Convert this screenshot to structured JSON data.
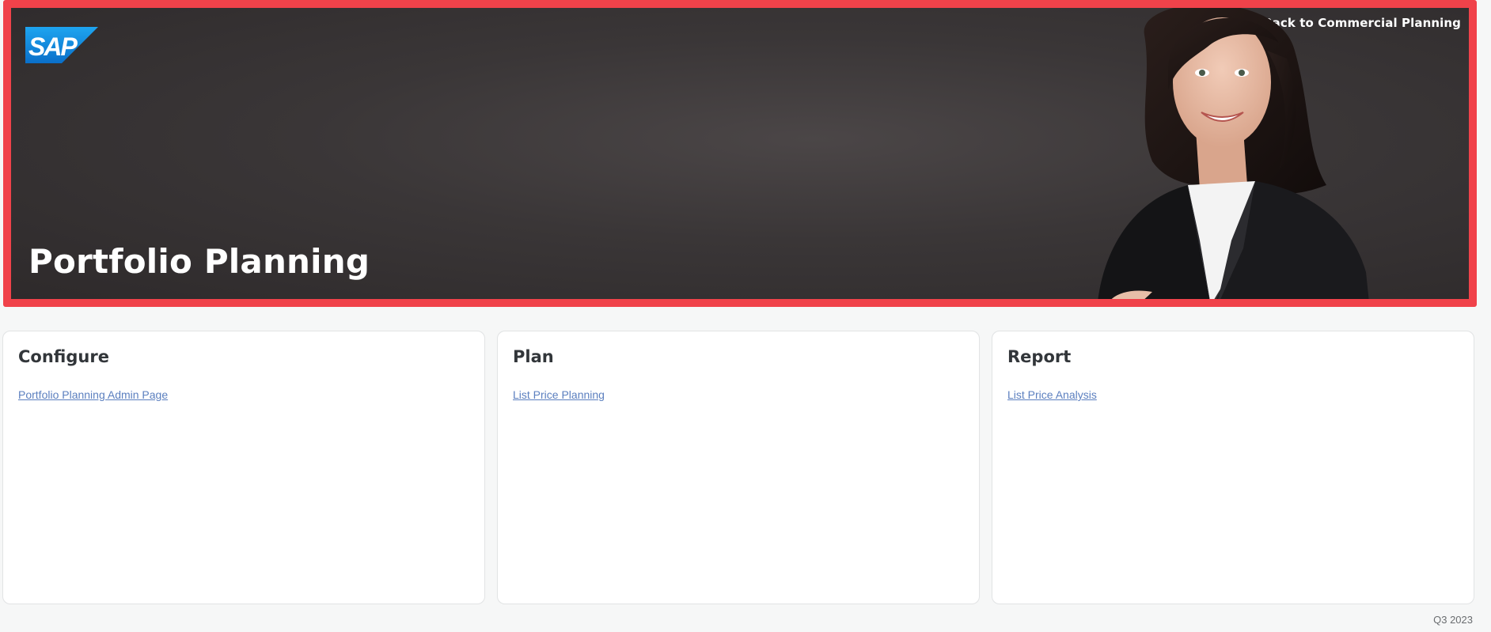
{
  "hero": {
    "title": "Portfolio Planning",
    "back_link": "Back to Commercial Planning",
    "logo_text": "SAP",
    "border_color": "#f0424a",
    "icons": {
      "back": "arrow-left-icon"
    }
  },
  "sections": [
    {
      "title": "Configure",
      "links": [
        "Portfolio Planning Admin Page"
      ]
    },
    {
      "title": "Plan",
      "links": [
        "List Price Planning"
      ]
    },
    {
      "title": "Report",
      "links": [
        "List Price Analysis"
      ]
    }
  ],
  "footer": {
    "release": "Q3 2023"
  },
  "colors": {
    "link": "#5b7fbf",
    "heading": "#32363a",
    "background": "#f6f7f7"
  }
}
